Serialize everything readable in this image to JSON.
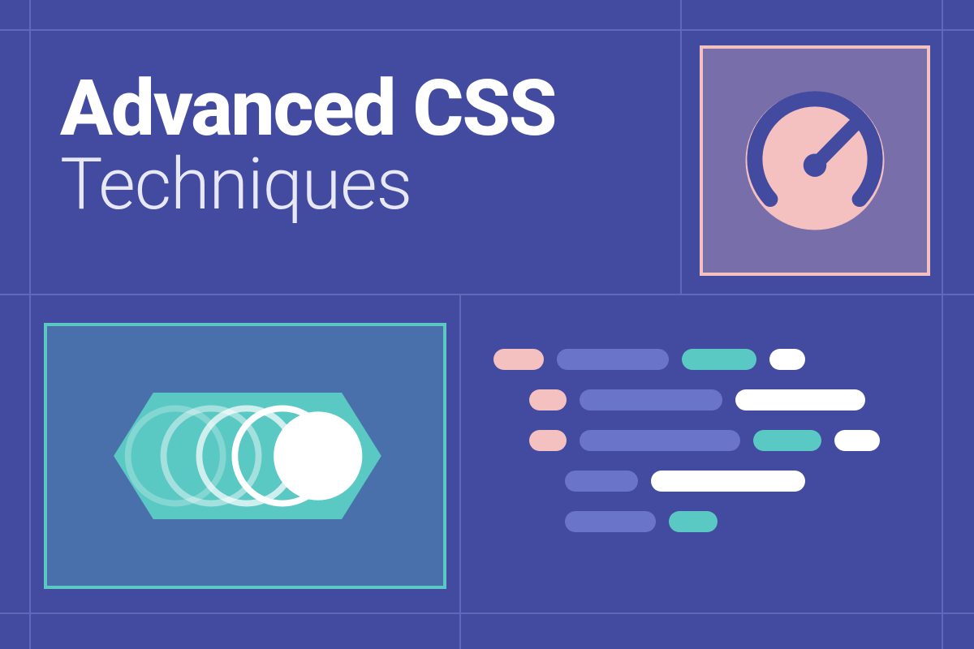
{
  "title": {
    "line1": "Advanced CSS",
    "line2": "Techniques"
  },
  "colors": {
    "background": "#434ba0",
    "grid": "#6068b8",
    "pink": "#f5c0c0",
    "teal": "#5ac8c3",
    "blue": "#6a74c9",
    "white": "#ffffff"
  },
  "cards": {
    "gauge": {
      "icon": "gauge-icon"
    },
    "animation": {
      "icon": "motion-trail-icon"
    },
    "code": {
      "icon": "code-tokens-icon"
    }
  }
}
